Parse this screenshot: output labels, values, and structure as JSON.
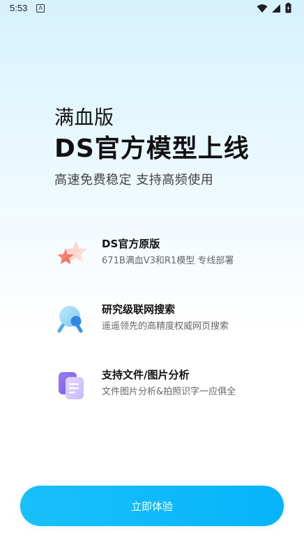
{
  "status_bar": {
    "time": "5:53",
    "notification_icon_letter": "A",
    "icons": [
      "wifi-icon",
      "signal-icon",
      "battery-icon"
    ]
  },
  "headline": {
    "line1": "满血版",
    "line2": "DS官方模型上线",
    "subtitle": "高速免费稳定 支持高频使用"
  },
  "features": [
    {
      "icon": "star-icon",
      "title": "DS官方原版",
      "desc": "671B满血V3和R1模型 专线部署"
    },
    {
      "icon": "magnifier-icon",
      "title": "研究级联网搜索",
      "desc": "遥遥领先的高精度权威网页搜索"
    },
    {
      "icon": "document-icon",
      "title": "支持文件/图片分析",
      "desc": "文件图片分析&拍照识字一应俱全"
    }
  ],
  "cta": {
    "label": "立即体验"
  },
  "colors": {
    "accent": "#0bb6fa",
    "background_top": "#d6f2fd",
    "background_bottom": "#ffffff"
  }
}
